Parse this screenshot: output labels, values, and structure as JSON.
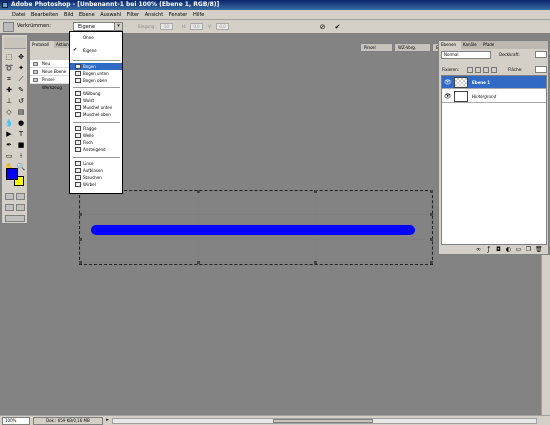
{
  "window": {
    "title": "Adobe Photoshop - [Unbenannt-1 bei 100% (Ebene 1, RGB/8)]"
  },
  "menu": [
    "Datei",
    "Bearbeiten",
    "Bild",
    "Ebene",
    "Auswahl",
    "Filter",
    "Ansicht",
    "Fenster",
    "Hilfe"
  ],
  "options": {
    "warp_label": "Verkrümmen:",
    "style_value": "Eigene",
    "bend_label": "Biegung:",
    "bend_value": "50",
    "h_label": "H:",
    "h_value": "0,0",
    "v_label": "V:",
    "v_value": "0,0",
    "palette_tabs": [
      "Pinsel",
      "WZ-Vorg.",
      "Ebenenkomp."
    ]
  },
  "history_panel": {
    "tabs": [
      "Protokoll",
      "Aktion"
    ],
    "rows": [
      "Neu",
      "Neue Ebene",
      "Pinsel-Werkzeug"
    ]
  },
  "warp_menu": {
    "items": [
      "Ohne",
      "Eigene",
      "Bogen",
      "Bogen unten",
      "Bogen oben",
      "Wölbung",
      "Wulst",
      "Muschel unten",
      "Muschel oben",
      "Flagge",
      "Welle",
      "Fisch",
      "Ansteigend",
      "Linse",
      "Aufblasen",
      "Stauchen",
      "Wirbel"
    ],
    "checked": "Eigene",
    "highlighted": "Bogen"
  },
  "layers_panel": {
    "tabs": [
      "Ebenen",
      "Kanäle",
      "Pfade"
    ],
    "blend_mode": "Normal",
    "opacity_label": "Deckkraft:",
    "fix_label": "Fixieren:",
    "fill_label": "Fläche:",
    "layers": [
      {
        "name": "Ebene 1",
        "selected": true
      },
      {
        "name": "Hintergrund",
        "selected": false
      }
    ]
  },
  "status": {
    "zoom": "100%",
    "doc": "Dok.: 659 KB/0,16 MB"
  },
  "colors": {
    "foreground": "#0000ff",
    "background": "#ffff00",
    "highlight": "#316ac5"
  }
}
